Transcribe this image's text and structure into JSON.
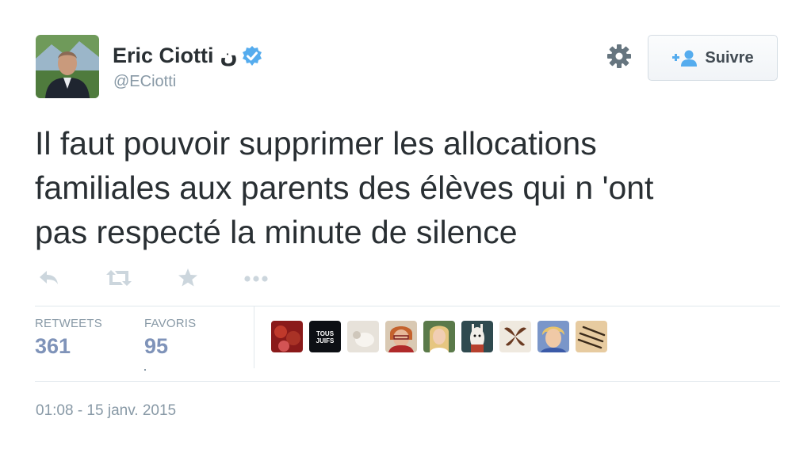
{
  "author": {
    "name": "Eric Ciotti",
    "arabic_mark": "ن",
    "handle": "@ECiotti",
    "avatar_icon": "user-avatar-photo",
    "verified_icon": "verified-badge-icon"
  },
  "follow_button": {
    "label": "Suivre",
    "icon": "add-user-icon"
  },
  "settings_icon": "gear-icon",
  "tweet": {
    "lines": [
      "Il faut pouvoir supprimer les allocations",
      "familiales aux parents des élèves qui n 'ont",
      "pas respecté la minute de silence"
    ]
  },
  "actions": [
    "reply-icon",
    "retweet-icon",
    "favorite-icon",
    "more-icon"
  ],
  "stats": {
    "retweets_label": "RETWEETS",
    "retweets_value": "361",
    "favorites_label": "FAVORIS",
    "favorites_value": "95"
  },
  "favoriters_avatar": {
    "text_label": "TOUS JUIFS"
  },
  "timestamp": "01:08 - 15 janv. 2015",
  "colors": {
    "accent": "#55acee",
    "stat_value": "#7f93b9",
    "muted": "#8899a6",
    "text": "#292f33"
  }
}
